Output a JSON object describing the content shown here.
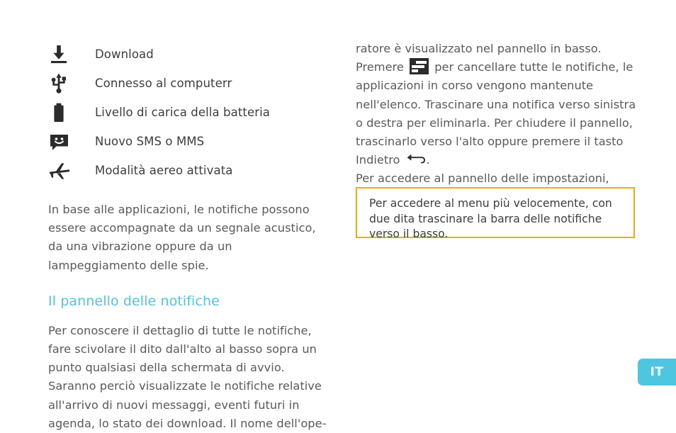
{
  "accent_color": "#4ec6e0",
  "callout_border_color": "#e4b207",
  "text_color": "#5a5a5a",
  "icon_color": "#2b2b2b",
  "left_column": {
    "icon_legend": [
      {
        "icon": "download-icon",
        "label": "Download"
      },
      {
        "icon": "usb-icon",
        "label": "Connesso al computerr"
      },
      {
        "icon": "battery-icon",
        "label": "Livello di carica della batteria"
      },
      {
        "icon": "sms-message-icon",
        "label": "Nuovo SMS o MMS"
      },
      {
        "icon": "airplane-mode-icon",
        "label": "Modalità aereo attivata"
      }
    ],
    "note_paragraph": "In base alle applicazioni, le notifiche possono essere accompagnate da un segnale acustico, da una vibrazione oppure da un lampeggiamento delle spie.",
    "section_heading": "Il pannello delle notifiche",
    "detail_paragraph": "Per conoscere il dettaglio di tutte le notifiche, fare scivolare il dito dall'alto al basso sopra un punto qualsiasi della schermata di avvio. Saranno perciò visualizzate le notifiche relative all'arrivo di nuovi messaggi, eventi futuri in agenda, lo stato dei download. Il nome dell'ope-"
  },
  "right_column": {
    "line_continuation": "ratore è visualizzato nel pannello in basso.",
    "clear_sentence_before": "Premere",
    "clear_icon": "clear-notifications-icon",
    "clear_sentence_after": "per cancellare tutte le notifiche,  le applicazioni in corso vengono mantenute nell'elenco. Trascinare una notifica verso sinistra o destra per eliminarla. Per chiudere il pannello, trascinarlo verso l'alto oppure premere il tasto Indietro",
    "back_icon": "back-arrow-icon",
    "back_sentence_after": ".",
    "settings_sentence_before": "Per accedere al pannello delle impostazioni, premere",
    "settings_icon": "widgets-grid-icon",
    "settings_sentence_after": ".",
    "callout_text": "Per accedere al menu più velocemente, con due dita trascinare la barra delle notifiche verso il basso."
  },
  "language_tab": {
    "label": "IT"
  }
}
